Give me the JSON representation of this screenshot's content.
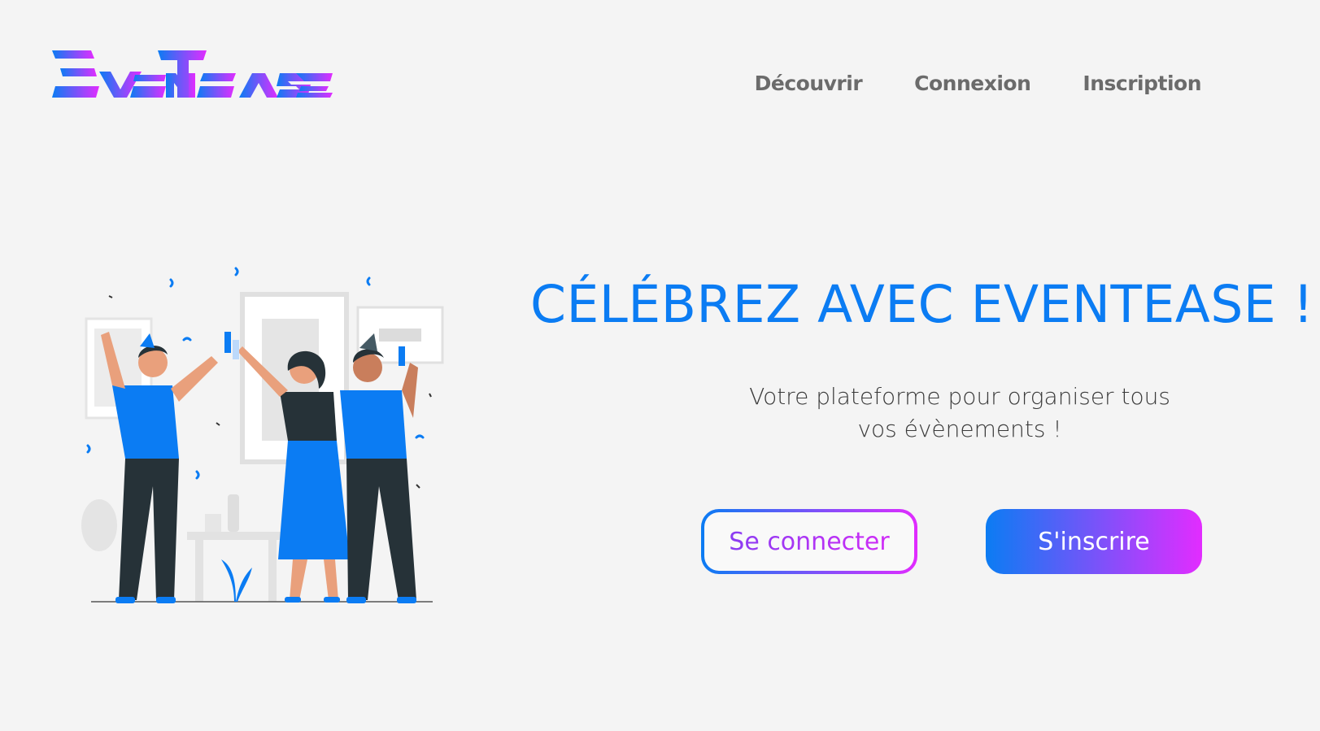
{
  "header": {
    "logo_text": "EVENTEASE",
    "nav": [
      {
        "label": "Découvrir"
      },
      {
        "label": "Connexion"
      },
      {
        "label": "Inscription"
      }
    ]
  },
  "hero": {
    "title": "CÉLÉBREZ AVEC EVENTEASE !",
    "subtitle_line1": "Votre plateforme pour organiser tous",
    "subtitle_line2": "vos évènements !",
    "login_button": "Se connecter",
    "signup_button": "S'inscrire"
  },
  "colors": {
    "brand_blue": "#0b7cf3",
    "brand_magenta": "#e22cff",
    "nav_text": "#6b6b6b",
    "background": "#f4f4f4"
  },
  "illustration": {
    "icon": "party-celebration-illustration"
  }
}
